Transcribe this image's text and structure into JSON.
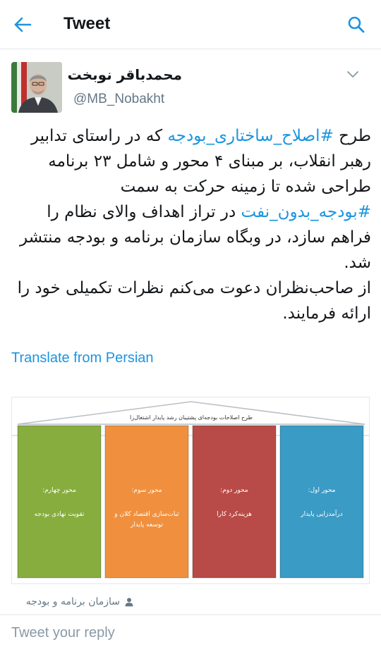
{
  "header": {
    "title": "Tweet",
    "back_icon": "arrow-left-icon",
    "search_icon": "search-icon",
    "accent_color": "#1b95e0"
  },
  "tweet": {
    "author_name": "محمدباقر نوبخت",
    "author_handle": "@MB_Nobakht",
    "text": {
      "p1_pre": "طرح ",
      "hashtag1": "#اصلاح_ساختاری_بودجه",
      "p1_mid": " که در راستای تدابیر رهبر انقلاب، بر مبنای ۴ محور و شامل ۲۳ برنامه طراحی شده تا زمینه حرکت به سمت ",
      "hashtag2": "#بودجه_بدون_نفت",
      "p1_post": " در تراز اهداف والای نظام را فراهم سازد، در وبگاه سازمان برنامه و بودجه منتشر شد.",
      "p2": "از صاحب‌نظران دعوت می‌کنم نظرات تکمیلی خود را ارائه فرمایند."
    },
    "translate_label": "Translate from Persian",
    "media": {
      "roof_label": "طرح اصلاحات بودجه‌ای پشتیبان رشد پایدار اشتغال‌زا",
      "pillars": [
        {
          "heading": "محور اول:",
          "line1": "درآمدزایی پایدار",
          "line2": "",
          "color": "#3a9bc4"
        },
        {
          "heading": "محور دوم:",
          "line1": "هزینه‌کرد کارا",
          "line2": "",
          "color": "#b84b47"
        },
        {
          "heading": "محور سوم:",
          "line1": "ثبات‌سازی اقتصاد کلان و",
          "line2": "توسعه پایدار",
          "color": "#f0903e"
        },
        {
          "heading": "محور چهارم:",
          "line1": "تقویت نهادی بودجه",
          "line2": "",
          "color": "#88ad3f"
        }
      ]
    },
    "attribution": "سازمان برنامه و بودجه",
    "attribution_icon": "person-icon"
  },
  "reply": {
    "placeholder": "Tweet your reply"
  }
}
